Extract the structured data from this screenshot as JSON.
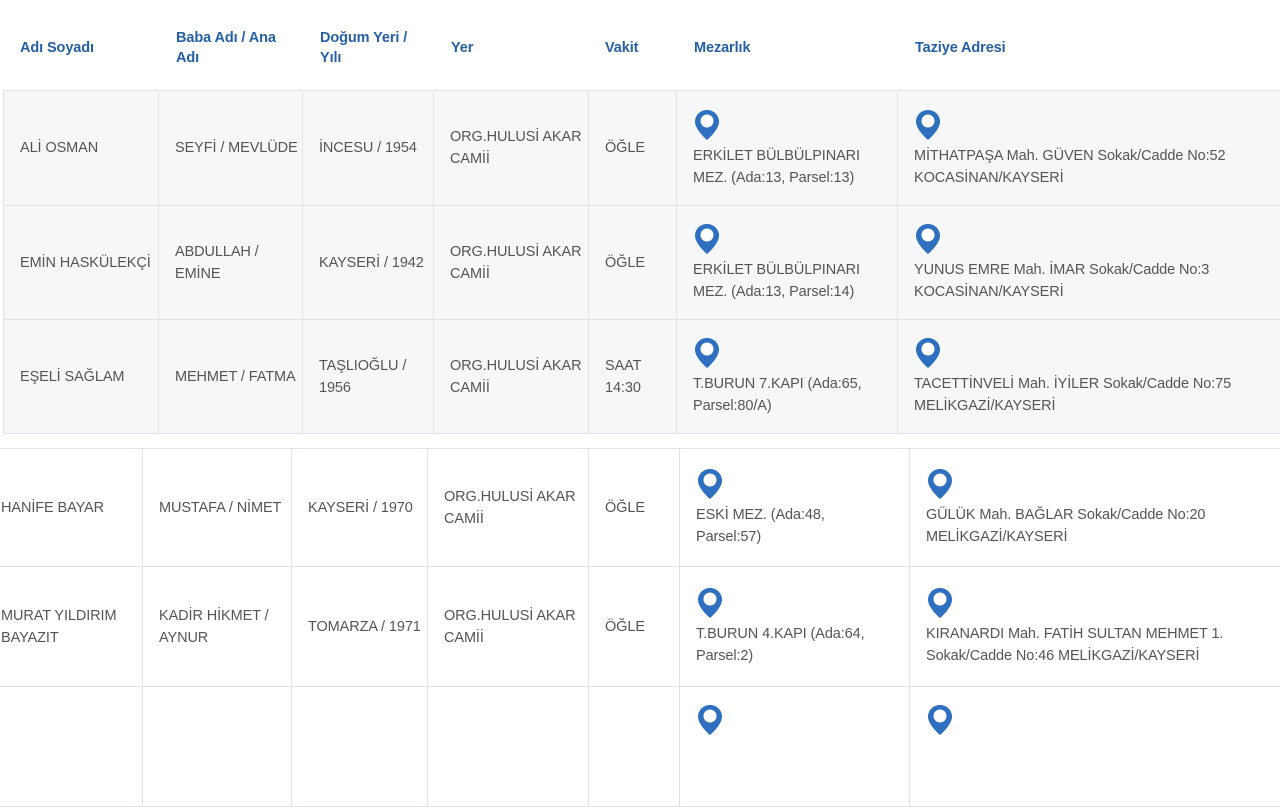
{
  "headers": {
    "name": "Adı Soyadı",
    "parents": "Baba Adı / Ana Adı",
    "birth": "Doğum Yeri / Yılı",
    "place": "Yer",
    "time": "Vakit",
    "cemetery": "Mezarlık",
    "condolence": "Taziye Adresi"
  },
  "icons": {
    "map_pin": "map-pin-icon",
    "pin_color": "#2e6fc0"
  },
  "rows": [
    {
      "name": "ALİ OSMAN",
      "parents": "SEYFİ / MEVLÜDE",
      "birth": "İNCESU / 1954",
      "place": "ORG.HULUSİ AKAR CAMİİ",
      "time": "ÖĞLE",
      "cemetery": "ERKİLET BÜLBÜLPINARI MEZ. (Ada:13, Parsel:13)",
      "condolence": "MİTHATPAŞA Mah. GÜVEN Sokak/Cadde No:52 KOCASİNAN/KAYSERİ"
    },
    {
      "name": "EMİN HASKÜLEKÇİ",
      "parents": "ABDULLAH / EMİNE",
      "birth": "KAYSERİ / 1942",
      "place": "ORG.HULUSİ AKAR CAMİİ",
      "time": "ÖĞLE",
      "cemetery": "ERKİLET BÜLBÜLPINARI MEZ. (Ada:13, Parsel:14)",
      "condolence": "YUNUS EMRE Mah. İMAR Sokak/Cadde No:3 KOCASİNAN/KAYSERİ"
    },
    {
      "name": "EŞELİ SAĞLAM",
      "parents": "MEHMET / FATMA",
      "birth": "TAŞLIOĞLU / 1956",
      "place": "ORG.HULUSİ AKAR CAMİİ",
      "time": "SAAT 14:30",
      "cemetery": "T.BURUN 7.KAPI (Ada:65, Parsel:80/A)",
      "condolence": "TACETTİNVELİ Mah. İYİLER Sokak/Cadde No:75 MELİKGAZİ/KAYSERİ"
    },
    {
      "name": "HANİFE BAYAR",
      "parents": "MUSTAFA / NİMET",
      "birth": "KAYSERİ / 1970",
      "place": "ORG.HULUSİ AKAR CAMİİ",
      "time": "ÖĞLE",
      "cemetery": "ESKİ MEZ. (Ada:48, Parsel:57)",
      "condolence": "GÜLÜK Mah. BAĞLAR Sokak/Cadde No:20 MELİKGAZİ/KAYSERİ"
    },
    {
      "name": "MURAT YILDIRIM BAYAZIT",
      "parents": "KADİR HİKMET / AYNUR",
      "birth": "TOMARZA / 1971",
      "place": "ORG.HULUSİ AKAR CAMİİ",
      "time": "ÖĞLE",
      "cemetery": "T.BURUN 4.KAPI (Ada:64, Parsel:2)",
      "condolence": "KIRANARDI Mah. FATİH SULTAN MEHMET 1. Sokak/Cadde No:46 MELİKGAZİ/KAYSERİ"
    }
  ]
}
